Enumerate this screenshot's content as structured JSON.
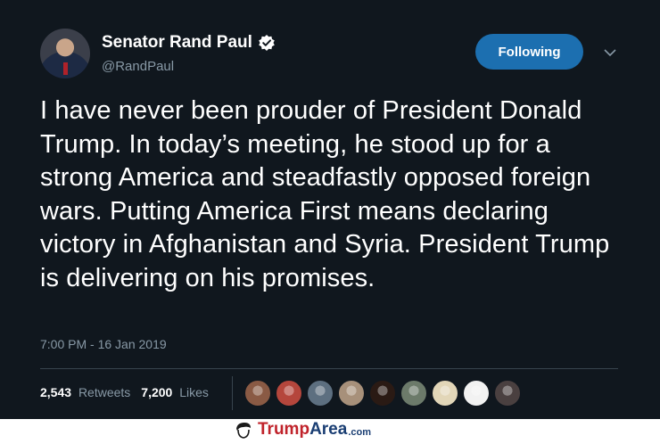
{
  "author": {
    "display_name": "Senator Rand Paul",
    "handle": "@RandPaul",
    "verified_icon": "verified-badge-icon",
    "avatar_icon": "avatar"
  },
  "follow_button": {
    "label": "Following"
  },
  "menu": {
    "icon": "chevron-down-icon"
  },
  "tweet": {
    "text": "I have never been prouder of President Donald Trump. In today’s meeting, he stood up for a strong America and steadfastly opposed foreign wars. Putting America First means declaring victory in Afghanistan and Syria. President Trump is delivering on his promises.",
    "timestamp": "7:00 PM - 16 Jan 2019"
  },
  "stats": {
    "retweets_count": "2,543",
    "retweets_label": "Retweets",
    "likes_count": "7,200",
    "likes_label": "Likes"
  },
  "likers": [
    {
      "icon": "liker-avatar",
      "color": "#8a5a44"
    },
    {
      "icon": "liker-avatar",
      "color": "#b5463c"
    },
    {
      "icon": "liker-avatar",
      "color": "#5d6f80"
    },
    {
      "icon": "liker-avatar",
      "color": "#a7907a"
    },
    {
      "icon": "liker-avatar",
      "color": "#2a1a14"
    },
    {
      "icon": "liker-avatar",
      "color": "#6c7a6a"
    },
    {
      "icon": "liker-avatar",
      "color": "#e2d6b8"
    },
    {
      "icon": "liker-avatar",
      "color": "#f2f2f2"
    },
    {
      "icon": "liker-avatar",
      "color": "#4a4040"
    }
  ],
  "watermark": {
    "brand_main": "Trump",
    "brand_accent": "Area",
    "brand_domain": ".com",
    "logo_icon": "trump-hair-logo-icon"
  },
  "colors": {
    "background": "#10171e",
    "button": "#1c6fb0",
    "muted_text": "#8899a6",
    "divider": "#38444d"
  }
}
